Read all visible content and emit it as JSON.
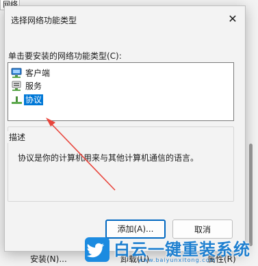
{
  "background": {
    "tab_label": "网络",
    "bottom_buttons": [
      "安装(N)...",
      "卸载(U)",
      "属性(R)"
    ]
  },
  "dialog": {
    "title": "选择网络功能类型",
    "close_glyph": "✕",
    "prompt": "单击要安装的网络功能类型(C):",
    "items": [
      {
        "label": "客户端",
        "icon": "network-client-icon"
      },
      {
        "label": "服务",
        "icon": "network-service-icon"
      },
      {
        "label": "协议",
        "icon": "network-protocol-icon",
        "selected": true
      }
    ],
    "description_label": "描述",
    "description_text": "协议是你的计算机用来与其他计算机通信的语言。",
    "buttons": {
      "add": "添加(A)...",
      "cancel": "取消"
    }
  },
  "watermark": {
    "text": "白云一键重装系统",
    "url": "www.baiyunxitong.com"
  },
  "colors": {
    "selection": "#0078d7",
    "default_button_border": "#0067c0",
    "annotation_arrow": "#e8453c",
    "watermark_blue": "#1e7fcf"
  }
}
